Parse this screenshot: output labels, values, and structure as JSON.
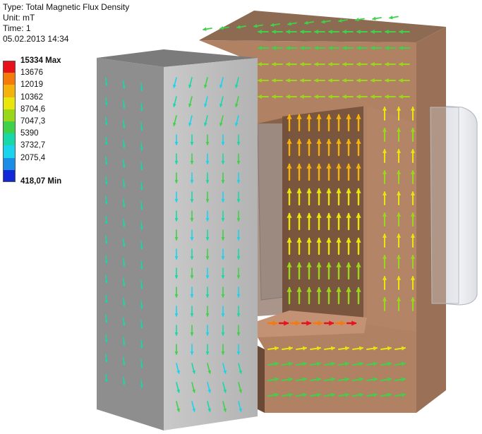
{
  "result_header": {
    "type": "Type: Total Magnetic Flux Density",
    "unit": "Unit: mT",
    "time": "Time: 1",
    "date": "05.02.2013 14:34"
  },
  "legend": {
    "entries": [
      {
        "label": "15334 Max",
        "color": "#e8101a",
        "bold": true
      },
      {
        "label": "13676",
        "color": "#f47a0b",
        "bold": false
      },
      {
        "label": "12019",
        "color": "#f5b10c",
        "bold": false
      },
      {
        "label": "10362",
        "color": "#e8e60d",
        "bold": false
      },
      {
        "label": "8704,6",
        "color": "#9ad61a",
        "bold": false
      },
      {
        "label": "7047,3",
        "color": "#3fd14a",
        "bold": false
      },
      {
        "label": "5390",
        "color": "#18d8a9",
        "bold": false
      },
      {
        "label": "3732,7",
        "color": "#19d4ec",
        "bold": false
      },
      {
        "label": "2075,4",
        "color": "#1a8de6",
        "bold": false
      }
    ],
    "bottom_color": "#1228d8",
    "min_label": "418,07 Min"
  },
  "scene": {
    "core_color": "#b08163",
    "pole_color": "#a8a8a8",
    "coil_color": "#c8ccd4"
  }
}
